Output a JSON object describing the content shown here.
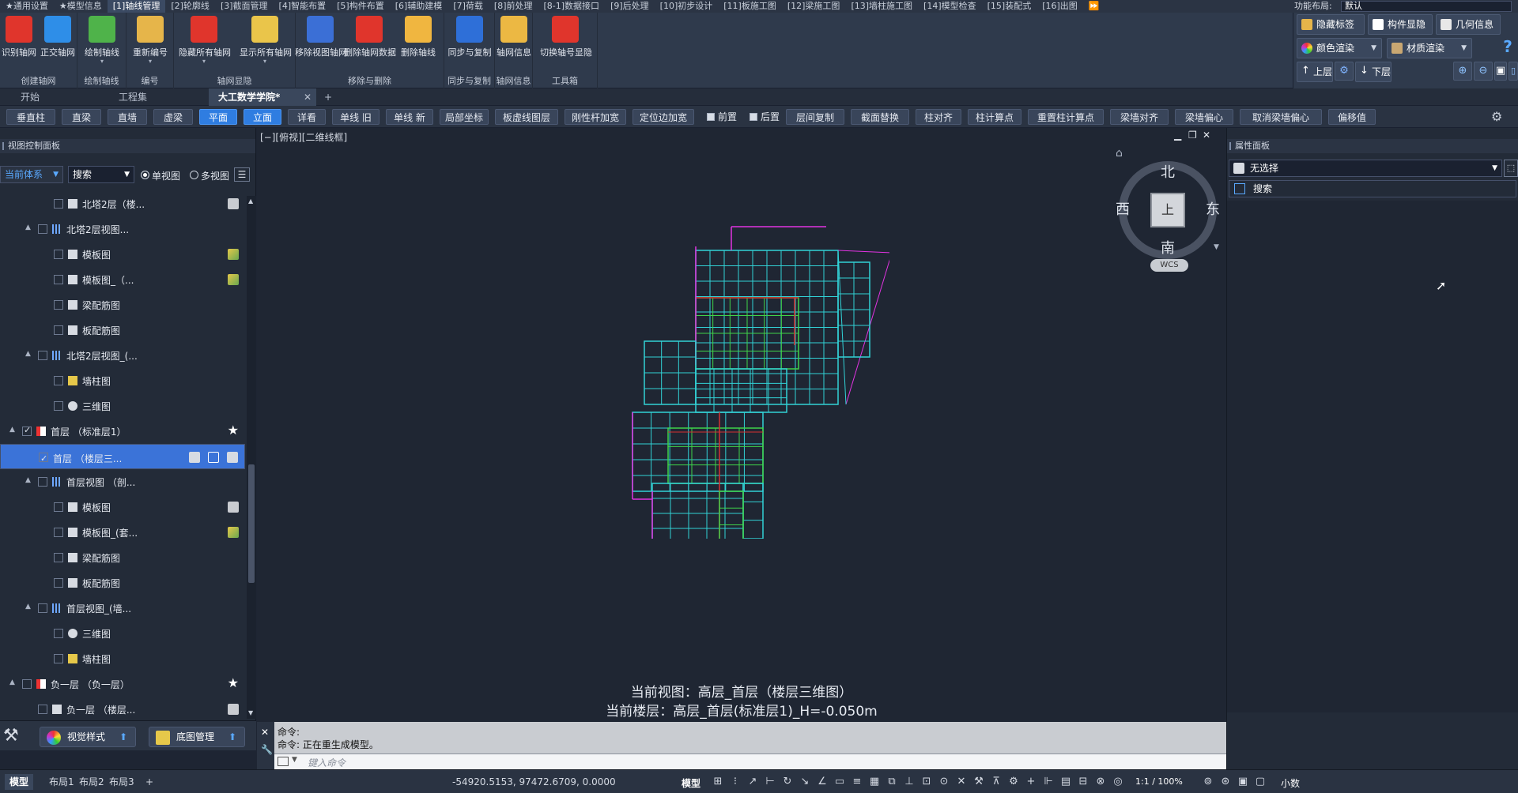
{
  "menu": {
    "items": [
      "★通用设置",
      "★模型信息",
      "[1]轴线管理",
      "[2]轮廓线",
      "[3]截面管理",
      "[4]智能布置",
      "[5]构件布置",
      "[6]辅助建模",
      "[7]荷载",
      "[8]前处理",
      "[8-1]数据接口",
      "[9]后处理",
      "[10]初步设计",
      "[11]板施工图",
      "[12]梁施工图",
      "[13]墙柱施工图",
      "[14]模型检查",
      "[15]装配式",
      "[16]出图",
      "⏩"
    ],
    "active_index": 2,
    "layout_label": "功能布局:",
    "layout_value": "默认"
  },
  "ribbon": {
    "groups": [
      {
        "label": "创建轴网",
        "buttons": [
          "识别轴网",
          "正交轴网"
        ]
      },
      {
        "label": "绘制轴线",
        "buttons": [
          "绘制轴线"
        ]
      },
      {
        "label": "编号",
        "buttons": [
          "重新编号"
        ]
      },
      {
        "label": "轴网显隐",
        "buttons": [
          "隐藏所有轴网",
          "显示所有轴网"
        ]
      },
      {
        "label": "移除与删除",
        "buttons": [
          "移除视图轴网",
          "删除轴网数据",
          "删除轴线"
        ]
      },
      {
        "label": "同步与复制",
        "buttons": [
          "同步与复制"
        ]
      },
      {
        "label": "轴网信息",
        "buttons": [
          "轴网信息"
        ]
      },
      {
        "label": "工具箱",
        "buttons": [
          "切换轴号显隐"
        ]
      }
    ],
    "group_dropdown_mark": "▾"
  },
  "right_top": {
    "hide_tag": "隐藏标签",
    "component_show": "构件显隐",
    "geometry_info": "几何信息",
    "color_render": "颜色渲染",
    "material_render": "材质渲染",
    "up_floor": "上层",
    "down_floor": "下层",
    "help": "?"
  },
  "doc_tabs": {
    "items": [
      "开始",
      "工程集",
      "大工数学学院*"
    ],
    "active_index": 2,
    "close": "✕",
    "add": "+"
  },
  "command_toolbar": {
    "items": [
      "垂直柱",
      "直梁",
      "直墙",
      "虚梁",
      "平面",
      "立面",
      "详看",
      "单线 旧",
      "单线 新",
      "局部坐标",
      "板虚线图层",
      "刚性杆加宽",
      "定位边加宽",
      "前置",
      "后置",
      "层间复制",
      "截面替换",
      "柱对齐",
      "柱计算点",
      "重置柱计算点",
      "梁墙对齐",
      "梁墙偏心",
      "取消梁墙偏心",
      "偏移值"
    ],
    "on": [
      "平面",
      "立面"
    ],
    "checkbox_items": [
      "前置",
      "后置"
    ]
  },
  "left_panel": {
    "title": "视图控制面板",
    "system_select": "当前体系",
    "search_select": "搜索",
    "single_view": "单视图",
    "multi_view": "多视图",
    "tree": [
      {
        "level": 3,
        "label": "北塔2层（楼...",
        "expand": "",
        "checked": false,
        "icon": "floor",
        "right": "gray"
      },
      {
        "level": 2,
        "label": "北塔2层视图...",
        "expand": "▲",
        "checked": false,
        "icon": "grid",
        "right": ""
      },
      {
        "level": 3,
        "label": "模板图",
        "expand": "",
        "checked": false,
        "icon": "sheet",
        "right": "img"
      },
      {
        "level": 3,
        "label": "模板图_（...",
        "expand": "",
        "checked": false,
        "icon": "sheet",
        "right": "img"
      },
      {
        "level": 3,
        "label": "梁配筋图",
        "expand": "",
        "checked": false,
        "icon": "sheet",
        "right": ""
      },
      {
        "level": 3,
        "label": "板配筋图",
        "expand": "",
        "checked": false,
        "icon": "sheet",
        "right": ""
      },
      {
        "level": 2,
        "label": "北塔2层视图_(...",
        "expand": "▲",
        "checked": false,
        "icon": "grid",
        "right": ""
      },
      {
        "level": 3,
        "label": "墙柱图",
        "expand": "",
        "checked": false,
        "icon": "yellow",
        "right": ""
      },
      {
        "level": 3,
        "label": "三维图",
        "expand": "",
        "checked": false,
        "icon": "cube",
        "right": ""
      },
      {
        "level": 1,
        "label": "首层 （标准层1）",
        "expand": "▲",
        "checked": true,
        "icon": "tower",
        "right": "star"
      },
      {
        "level": 2,
        "label": "首层 （楼层三...",
        "expand": "",
        "checked": true,
        "icon": "none",
        "right": "tools",
        "selected": true
      },
      {
        "level": 2,
        "label": "首层视图 （剖...",
        "expand": "▲",
        "checked": false,
        "icon": "grid",
        "right": ""
      },
      {
        "level": 3,
        "label": "模板图",
        "expand": "",
        "checked": false,
        "icon": "sheet",
        "right": "gray"
      },
      {
        "level": 3,
        "label": "模板图_(套...",
        "expand": "",
        "checked": false,
        "icon": "sheet",
        "right": "img"
      },
      {
        "level": 3,
        "label": "梁配筋图",
        "expand": "",
        "checked": false,
        "icon": "sheet",
        "right": ""
      },
      {
        "level": 3,
        "label": "板配筋图",
        "expand": "",
        "checked": false,
        "icon": "sheet",
        "right": ""
      },
      {
        "level": 2,
        "label": "首层视图_(墙...",
        "expand": "▲",
        "checked": false,
        "icon": "grid",
        "right": ""
      },
      {
        "level": 3,
        "label": "三维图",
        "expand": "",
        "checked": false,
        "icon": "cube",
        "right": ""
      },
      {
        "level": 3,
        "label": "墙柱图",
        "expand": "",
        "checked": false,
        "icon": "yellow",
        "right": ""
      },
      {
        "level": 1,
        "label": "负一层 （负一层）",
        "expand": "▲",
        "checked": false,
        "icon": "tower",
        "right": "star"
      },
      {
        "level": 2,
        "label": "负一层 （楼层...",
        "expand": "",
        "checked": false,
        "icon": "floor",
        "right": "gray"
      }
    ],
    "visual_style": "视觉样式",
    "base_map": "底图管理"
  },
  "viewport": {
    "title": "[−][俯视][二维线框]",
    "north": "北",
    "south": "南",
    "east": "东",
    "west": "西",
    "cube_face": "上",
    "wcs": "WCS",
    "current_view": "当前视图：高层_首层（楼层三维图）",
    "current_floor": "当前楼层：高层_首层(标准层1)_H=-0.050m"
  },
  "command_line": {
    "line1": "命令:",
    "line2": "命令: 正在重生成模型。",
    "placeholder": "键入命令"
  },
  "right_panel": {
    "title": "属性面板",
    "select_value": "无选择",
    "search": "搜索"
  },
  "status_bar": {
    "tabs": [
      "模型",
      "布局1",
      "布局2",
      "布局3",
      "+"
    ],
    "active_index": 0,
    "coords": "-54920.5153, 97472.6709, 0.0000",
    "model_label": "模型",
    "scale": "1:1 / 100%",
    "decimal": "小数"
  },
  "colors": {
    "accent": "#2f7de1",
    "cyan_lines": "#32d2d6",
    "green_lines": "#3fd44a",
    "magenta_lines": "#e233e2",
    "red_lines": "#d63030"
  }
}
